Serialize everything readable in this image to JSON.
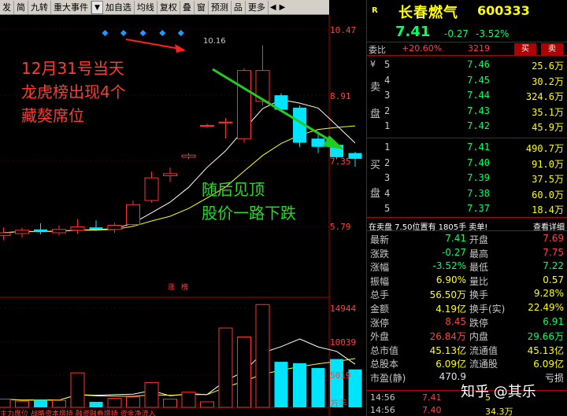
{
  "toolbar": {
    "items": [
      "发",
      "简",
      "九转",
      "重大事件",
      "加自选",
      "均线",
      "复权",
      "叠",
      "窗",
      "预测",
      "品",
      "更多"
    ],
    "dropdown_icon": "chevron-down-icon",
    "nav_left": "◀",
    "nav_right": "▶"
  },
  "annotations": {
    "red_lines": [
      "12月31号当天",
      "龙虎榜出现4个",
      "藏獒席位"
    ],
    "green_lines": [
      "随后见顶",
      "股价一路下跌"
    ]
  },
  "chart": {
    "price_axis": [
      "10.47",
      "8.91",
      "7.35",
      "5.79"
    ],
    "volume_axis": [
      "14944",
      "10039",
      "5019",
      "万手"
    ],
    "peak_label": "10.16",
    "zhangbang": "涨榜",
    "bottom_strip": "  主力席位    战略资本增持   融资融券增持   资金净流入"
  },
  "chart_data": {
    "type": "candlestick",
    "price_range": [
      5.2,
      10.8
    ],
    "candles": [
      {
        "o": 5.55,
        "h": 5.75,
        "l": 5.45,
        "c": 5.62
      },
      {
        "o": 5.6,
        "h": 5.74,
        "l": 5.5,
        "c": 5.68
      },
      {
        "o": 5.7,
        "h": 5.85,
        "l": 5.58,
        "c": 5.64
      },
      {
        "o": 5.62,
        "h": 5.8,
        "l": 5.55,
        "c": 5.7
      },
      {
        "o": 5.68,
        "h": 5.95,
        "l": 5.6,
        "c": 5.76
      },
      {
        "o": 5.75,
        "h": 5.92,
        "l": 5.66,
        "c": 5.7
      },
      {
        "o": 5.7,
        "h": 5.86,
        "l": 5.62,
        "c": 5.8
      },
      {
        "o": 5.82,
        "h": 6.4,
        "l": 5.78,
        "c": 6.3
      },
      {
        "o": 6.4,
        "h": 7.1,
        "l": 6.35,
        "c": 6.95
      },
      {
        "o": 7.0,
        "h": 7.2,
        "l": 6.85,
        "c": 7.05
      },
      {
        "o": 7.45,
        "h": 7.55,
        "l": 7.4,
        "c": 7.5
      },
      {
        "o": 8.2,
        "h": 8.26,
        "l": 8.16,
        "c": 8.22
      },
      {
        "o": 8.3,
        "h": 8.4,
        "l": 7.9,
        "c": 8.3
      },
      {
        "o": 7.9,
        "h": 9.6,
        "l": 7.8,
        "c": 9.55
      },
      {
        "o": 8.8,
        "h": 10.16,
        "l": 8.7,
        "c": 9.55
      },
      {
        "o": 8.95,
        "h": 9.0,
        "l": 8.55,
        "c": 8.6
      },
      {
        "o": 8.65,
        "h": 8.7,
        "l": 7.7,
        "c": 7.8
      },
      {
        "o": 7.9,
        "h": 8.0,
        "l": 7.55,
        "c": 7.7
      },
      {
        "o": 7.75,
        "h": 7.8,
        "l": 7.4,
        "c": 7.45
      },
      {
        "o": 7.55,
        "h": 7.58,
        "l": 7.22,
        "c": 7.41
      }
    ],
    "volume": [
      1200,
      900,
      1100,
      1000,
      5000,
      800,
      1300,
      1500,
      3600,
      1200,
      2200,
      800,
      11500,
      10200,
      14900,
      6600,
      6400,
      5700,
      7000,
      5500
    ],
    "volume_range": [
      0,
      15500
    ]
  },
  "quote": {
    "flag": "R",
    "name": "长春燃气",
    "code": "600333",
    "last": "7.41",
    "change": "-0.27",
    "change_pct": "-3.52%",
    "ratio_label": "委比",
    "ratio": "+20.60%",
    "ratio_diff": "3219",
    "sell_btn": "买",
    "buy_btn": "卖",
    "ask_side": [
      "¥",
      "卖",
      "盘"
    ],
    "asks": [
      {
        "lvl": "5",
        "price": "7.46",
        "vol": "25.6万"
      },
      {
        "lvl": "4",
        "price": "7.45",
        "vol": "30.2万"
      },
      {
        "lvl": "3",
        "price": "7.44",
        "vol": "324.6万"
      },
      {
        "lvl": "2",
        "price": "7.43",
        "vol": "35.1万"
      },
      {
        "lvl": "1",
        "price": "7.42",
        "vol": "45.9万"
      }
    ],
    "bid_side": [
      "买",
      "盘"
    ],
    "bids": [
      {
        "lvl": "1",
        "price": "7.41",
        "vol": "490.7万"
      },
      {
        "lvl": "2",
        "price": "7.40",
        "vol": "91.0万"
      },
      {
        "lvl": "3",
        "price": "7.39",
        "vol": "37.5万"
      },
      {
        "lvl": "4",
        "price": "7.38",
        "vol": "60.0万"
      },
      {
        "lvl": "5",
        "price": "7.37",
        "vol": "18.4万"
      }
    ],
    "notice": "在卖盘 7.50位置有 1805手 卖单!",
    "notice_link": "查看详细",
    "stats": [
      {
        "k": "最新",
        "v": "7.41",
        "vc": "col-green",
        "k2": "开盘",
        "v2": "7.69",
        "v2c": "col-red"
      },
      {
        "k": "涨跌",
        "v": "-0.27",
        "vc": "col-green",
        "k2": "最高",
        "v2": "7.75",
        "v2c": "col-red"
      },
      {
        "k": "涨幅",
        "v": "-3.52%",
        "vc": "col-green",
        "k2": "最低",
        "v2": "7.22",
        "v2c": "col-green"
      },
      {
        "k": "振幅",
        "v": "6.90%",
        "vc": "col-yellow",
        "k2": "量比",
        "v2": "0.57",
        "v2c": "col-yellow"
      },
      {
        "k": "总手",
        "v": "56.50万",
        "vc": "col-yellow",
        "k2": "换手",
        "v2": "9.28%",
        "v2c": "col-yellow"
      },
      {
        "k": "金额",
        "v": "4.19亿",
        "vc": "col-yellow",
        "k2": "换手(实)",
        "v2": "22.49%",
        "v2c": "col-yellow"
      },
      {
        "k": "涨停",
        "v": "8.45",
        "vc": "col-red",
        "k2": "跌停",
        "v2": "6.91",
        "v2c": "col-green"
      },
      {
        "k": "外盘",
        "v": "26.84万",
        "vc": "col-red",
        "k2": "内盘",
        "v2": "29.66万",
        "v2c": "col-green"
      },
      {
        "k": "总市值",
        "v": "45.13亿",
        "vc": "col-yellow",
        "k2": "流通值",
        "v2": "45.13亿",
        "v2c": "col-yellow"
      },
      {
        "k": "总股本",
        "v": "6.09亿",
        "vc": "col-yellow",
        "k2": "流通股",
        "v2": "6.09亿",
        "v2c": "col-yellow"
      },
      {
        "k": "市盈(静)",
        "v": "470.9",
        "vc": "col-white",
        "k2": "",
        "v2": "亏损",
        "v2c": "col-white"
      }
    ],
    "ticks": [
      {
        "t": "14:56",
        "p": "7.41",
        "v": "5"
      },
      {
        "t": "14:56",
        "p": "7.40",
        "v": "34.3万"
      }
    ]
  },
  "watermark": "知乎 @其乐"
}
